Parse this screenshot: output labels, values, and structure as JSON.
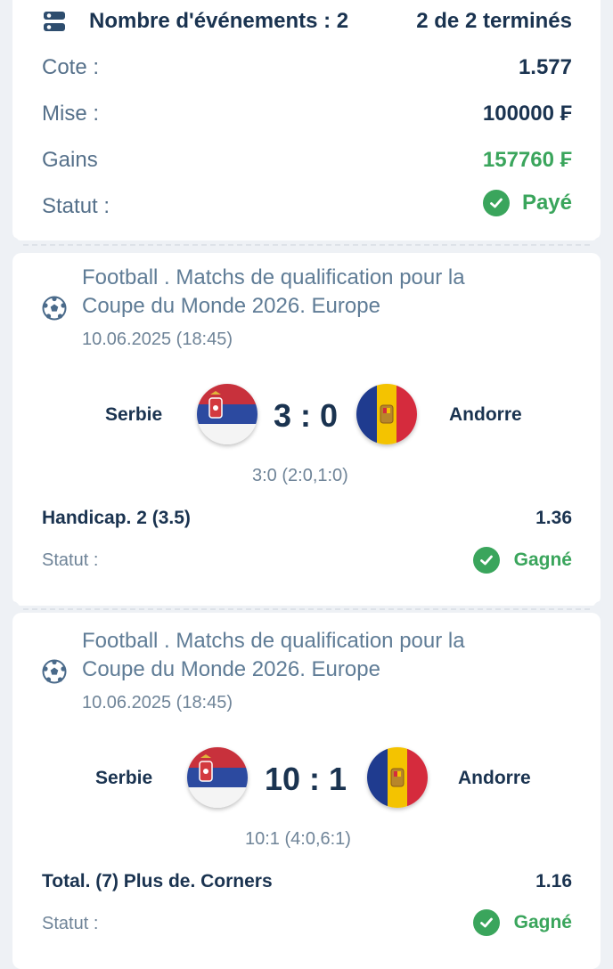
{
  "summary": {
    "events_label": "Nombre d'événements : 2",
    "completed_label": "2 de 2 terminés",
    "odds_label": "Cote :",
    "odds_value": "1.577",
    "stake_label": "Mise :",
    "stake_value": "100000 ₣",
    "winnings_label": "Gains",
    "winnings_value": "157760 ₣",
    "status_label": "Statut :",
    "status_value": "Payé"
  },
  "events": [
    {
      "title_line1": "Football . Matchs de qualification pour la",
      "title_line2": "Coupe du Monde 2026. Europe",
      "date": "10.06.2025 (18:45)",
      "home": "Serbie",
      "away": "Andorre",
      "score": "3 : 0",
      "score_detail": "3:0 (2:0,1:0)",
      "market": "Handicap. 2 (3.5)",
      "odd": "1.36",
      "status_label": "Statut :",
      "status": "Gagné"
    },
    {
      "title_line1": "Football . Matchs de qualification pour la",
      "title_line2": "Coupe du Monde 2026. Europe",
      "date": "10.06.2025 (18:45)",
      "home": "Serbie",
      "away": "Andorre",
      "score": "10 : 1",
      "score_detail": "10:1 (4:0,6:1)",
      "market": "Total. (7) Plus de. Corners",
      "odd": "1.16",
      "status_label": "Statut :",
      "status": "Gagné"
    }
  ],
  "icons": {
    "summary": "list-settings-icon",
    "sport": "soccer-ball-icon",
    "status": "check-circle-icon",
    "home_flag": "serbia-flag-icon",
    "away_flag": "andorra-flag-icon"
  },
  "colors": {
    "accent_green": "#3aa55c",
    "text_dark": "#1a3350",
    "text_muted": "#6f8498",
    "background": "#eef1f5"
  }
}
